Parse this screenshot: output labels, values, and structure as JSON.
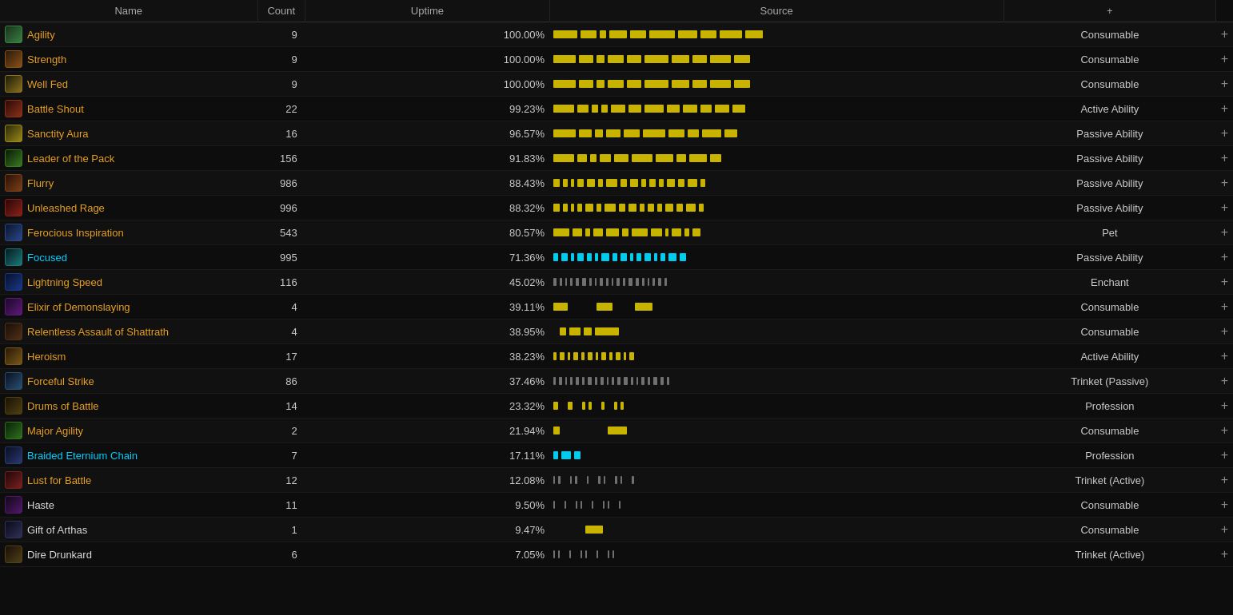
{
  "header": {
    "name": "Name",
    "count": "Count",
    "uptime": "Uptime",
    "source": "Source",
    "add": "+"
  },
  "rows": [
    {
      "id": "agility",
      "name": "Agility",
      "nameColor": "orange",
      "iconColor": "#5a8a3a",
      "iconBg": "#2a4a1a",
      "count": 9,
      "pct": "100.00%",
      "source": "Consumable",
      "barColor": "gold",
      "bars": [
        30,
        20,
        8,
        22,
        20,
        32,
        24,
        20,
        28,
        22
      ]
    },
    {
      "id": "strength",
      "name": "Strength",
      "nameColor": "orange",
      "iconColor": "#8a5a1a",
      "iconBg": "#3a2a0a",
      "count": 9,
      "pct": "100.00%",
      "source": "Consumable",
      "barColor": "gold",
      "bars": [
        28,
        18,
        10,
        20,
        18,
        30,
        22,
        18,
        26,
        20
      ]
    },
    {
      "id": "well-fed",
      "name": "Well Fed",
      "nameColor": "orange",
      "iconColor": "#7a6a2a",
      "iconBg": "#2a2a10",
      "count": 9,
      "pct": "100.00%",
      "source": "Consumable",
      "barColor": "gold",
      "bars": [
        28,
        18,
        10,
        20,
        18,
        30,
        22,
        18,
        26,
        20
      ]
    },
    {
      "id": "battle-shout",
      "name": "Battle Shout",
      "nameColor": "orange",
      "iconColor": "#8a3a1a",
      "iconBg": "#3a1a0a",
      "count": 22,
      "pct": "99.23%",
      "source": "Active Ability",
      "barColor": "gold",
      "bars": [
        26,
        14,
        8,
        8,
        18,
        16,
        24,
        16,
        18,
        14,
        18,
        16
      ]
    },
    {
      "id": "sanctity-aura",
      "name": "Sanctity Aura",
      "nameColor": "orange",
      "iconColor": "#9a8a2a",
      "iconBg": "#3a3a10",
      "count": 16,
      "pct": "96.57%",
      "source": "Passive Ability",
      "barColor": "gold",
      "bars": [
        28,
        16,
        10,
        18,
        20,
        28,
        20,
        14,
        24,
        16
      ]
    },
    {
      "id": "leader-of-the-pack",
      "name": "Leader of the Pack",
      "nameColor": "orange",
      "iconColor": "#4a8a2a",
      "iconBg": "#1a3a0a",
      "count": 156,
      "pct": "91.83%",
      "source": "Passive Ability",
      "barColor": "gold",
      "bars": [
        26,
        12,
        8,
        14,
        18,
        26,
        22,
        12,
        22,
        14
      ]
    },
    {
      "id": "flurry",
      "name": "Flurry",
      "nameColor": "orange",
      "iconColor": "#8a4a1a",
      "iconBg": "#3a1a08",
      "count": 986,
      "pct": "88.43%",
      "source": "Passive Ability",
      "barColor": "gold",
      "bars": [
        8,
        6,
        4,
        8,
        10,
        6,
        14,
        8,
        10,
        6,
        8,
        6,
        10,
        8,
        12,
        6
      ]
    },
    {
      "id": "unleashed-rage",
      "name": "Unleashed Rage",
      "nameColor": "orange",
      "iconColor": "#9a2a1a",
      "iconBg": "#3a0a08",
      "count": 996,
      "pct": "88.32%",
      "source": "Passive Ability",
      "barColor": "gold",
      "bars": [
        8,
        6,
        4,
        6,
        10,
        6,
        14,
        8,
        10,
        6,
        8,
        6,
        10,
        8,
        12,
        6
      ]
    },
    {
      "id": "ferocious-inspiration",
      "name": "Ferocious Inspiration",
      "nameColor": "orange",
      "iconColor": "#2a5a8a",
      "iconBg": "#0a1a3a",
      "count": 543,
      "pct": "80.57%",
      "source": "Pet",
      "barColor": "gold",
      "bars": [
        20,
        12,
        6,
        12,
        16,
        8,
        20,
        14,
        4,
        12,
        6,
        10
      ]
    },
    {
      "id": "focused",
      "name": "Focused",
      "nameColor": "cyan",
      "iconColor": "#1a8a8a",
      "iconBg": "#0a2a2a",
      "count": 995,
      "pct": "71.36%",
      "source": "Passive Ability",
      "barColor": "cyan",
      "bars": [
        6,
        8,
        4,
        8,
        6,
        4,
        10,
        6,
        8,
        4,
        6,
        8,
        4,
        6,
        10,
        8
      ]
    },
    {
      "id": "lightning-speed",
      "name": "Lightning Speed",
      "nameColor": "orange",
      "iconColor": "#1a4a9a",
      "iconBg": "#0a1a3a",
      "count": 116,
      "pct": "45.02%",
      "source": "Enchant",
      "barColor": "gray",
      "bars": [
        4,
        3,
        2,
        3,
        4,
        5,
        3,
        2,
        4,
        3,
        2,
        4,
        3,
        5,
        4,
        3,
        2,
        3,
        4,
        3
      ]
    },
    {
      "id": "elixir-of-demonslaying",
      "name": "Elixir of Demonslaying",
      "nameColor": "orange",
      "iconColor": "#6a2a8a",
      "iconBg": "#2a0a3a",
      "count": 4,
      "pct": "39.11%",
      "source": "Consumable",
      "barColor": "gold",
      "bars": [
        18,
        0,
        0,
        0,
        0,
        20,
        0,
        0,
        0,
        22,
        0,
        0
      ]
    },
    {
      "id": "relentless-assault",
      "name": "Relentless Assault of Shattrath",
      "nameColor": "orange",
      "iconColor": "#5a3a2a",
      "iconBg": "#1a1008",
      "count": 4,
      "pct": "38.95%",
      "source": "Consumable",
      "barColor": "gold",
      "bars": [
        0,
        8,
        14,
        10,
        30,
        0,
        0,
        0,
        0,
        0
      ]
    },
    {
      "id": "heroism",
      "name": "Heroism",
      "nameColor": "orange",
      "iconColor": "#8a6a1a",
      "iconBg": "#3a2a08",
      "count": 17,
      "pct": "38.23%",
      "source": "Active Ability",
      "barColor": "gold",
      "bars": [
        4,
        6,
        3,
        6,
        4,
        6,
        3,
        6,
        4,
        6,
        3,
        6
      ]
    },
    {
      "id": "forceful-strike",
      "name": "Forceful Strike",
      "nameColor": "orange",
      "iconColor": "#3a6a8a",
      "iconBg": "#0a1a2a",
      "count": 86,
      "pct": "37.46%",
      "source": "Trinket (Passive)",
      "barColor": "gray",
      "bars": [
        3,
        4,
        2,
        3,
        4,
        3,
        5,
        3,
        4,
        2,
        3,
        4,
        5,
        3,
        2,
        4,
        3,
        5,
        4,
        3
      ]
    },
    {
      "id": "drums-of-battle",
      "name": "Drums of Battle",
      "nameColor": "orange",
      "iconColor": "#5a4a1a",
      "iconBg": "#1a1808",
      "count": 14,
      "pct": "23.32%",
      "source": "Profession",
      "barColor": "gold",
      "bars": [
        6,
        0,
        6,
        0,
        4,
        4,
        0,
        4,
        0,
        4,
        4,
        0
      ]
    },
    {
      "id": "major-agility",
      "name": "Major Agility",
      "nameColor": "orange",
      "iconColor": "#3a7a2a",
      "iconBg": "#0a2a08",
      "count": 2,
      "pct": "21.94%",
      "source": "Consumable",
      "barColor": "gold",
      "bars": [
        8,
        0,
        0,
        0,
        0,
        0,
        0,
        0,
        24,
        0,
        0,
        0
      ]
    },
    {
      "id": "braided-eternium-chain",
      "name": "Braided Eternium Chain",
      "nameColor": "cyan",
      "iconColor": "#2a4a7a",
      "iconBg": "#0a1028",
      "count": 7,
      "pct": "17.11%",
      "source": "Profession",
      "barColor": "cyan",
      "bars": [
        6,
        12,
        8,
        0,
        0,
        0,
        0,
        0,
        0,
        0,
        0,
        0
      ]
    },
    {
      "id": "lust-for-battle",
      "name": "Lust for Battle",
      "nameColor": "orange",
      "iconColor": "#8a2a2a",
      "iconBg": "#2a0808",
      "count": 12,
      "pct": "12.08%",
      "source": "Trinket (Active)",
      "barColor": "gray",
      "bars": [
        2,
        3,
        0,
        2,
        3,
        0,
        2,
        0,
        3,
        2,
        0,
        3,
        2,
        0,
        3
      ]
    },
    {
      "id": "haste",
      "name": "Haste",
      "nameColor": "white",
      "iconColor": "#6a2a7a",
      "iconBg": "#1a0828",
      "count": 11,
      "pct": "9.50%",
      "source": "Consumable",
      "barColor": "gray",
      "bars": [
        2,
        0,
        2,
        0,
        2,
        2,
        0,
        2,
        0,
        2,
        2,
        0,
        2
      ]
    },
    {
      "id": "gift-of-arthas",
      "name": "Gift of Arthas",
      "nameColor": "white",
      "iconColor": "#3a3a5a",
      "iconBg": "#0a0a1a",
      "count": 1,
      "pct": "9.47%",
      "source": "Consumable",
      "barColor": "gold",
      "bars": [
        0,
        0,
        0,
        0,
        0,
        22,
        0,
        0,
        0,
        0,
        0,
        0
      ]
    },
    {
      "id": "dire-drunkard",
      "name": "Dire Drunkard",
      "nameColor": "white",
      "iconColor": "#5a3a1a",
      "iconBg": "#1a1008",
      "count": 6,
      "pct": "7.05%",
      "source": "Trinket (Active)",
      "barColor": "gray",
      "bars": [
        2,
        2,
        0,
        2,
        0,
        2,
        2,
        0,
        2,
        0,
        2,
        2
      ]
    }
  ]
}
